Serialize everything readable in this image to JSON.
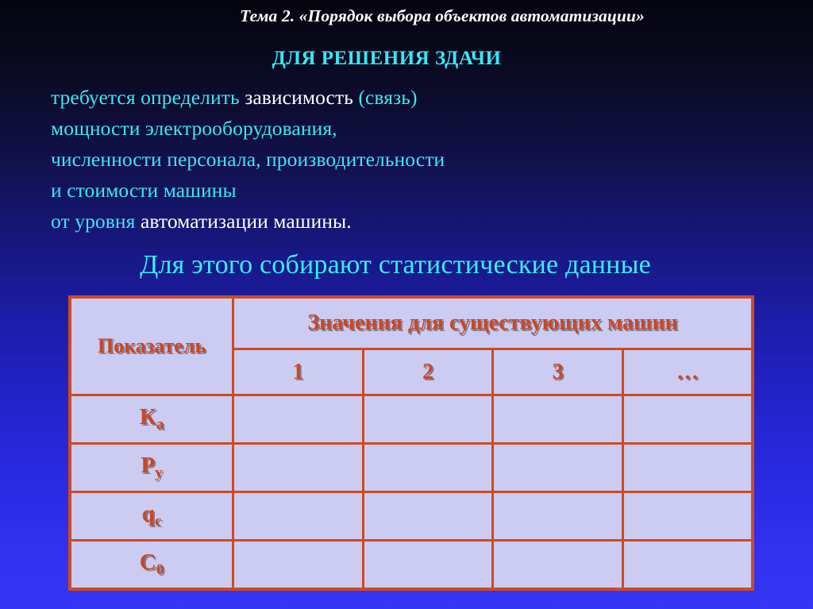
{
  "slide": {
    "title": "Тема 2. «Порядок выбора объектов автоматизации»",
    "sub_headline": "ДЛЯ РЕШЕНИЯ ЗДАЧИ",
    "statement": "Для этого собирают статистические данные",
    "body_lines": [
      {
        "segments": [
          {
            "text": "требуется определить ",
            "color": "cyan"
          },
          {
            "text": "зависимость ",
            "color": "white"
          },
          {
            "text": "(связь)",
            "color": "cyan"
          }
        ]
      },
      {
        "segments": [
          {
            "text": "мощности электрооборудования,",
            "color": "cyan"
          }
        ]
      },
      {
        "segments": [
          {
            "text": "численности персонала, производительности",
            "color": "cyan"
          }
        ]
      },
      {
        "segments": [
          {
            "text": "и стоимости машины",
            "color": "cyan"
          }
        ]
      },
      {
        "segments": [
          {
            "text": "от уровня ",
            "color": "cyan"
          },
          {
            "text": "автоматизации  машины.",
            "color": "white"
          }
        ]
      }
    ]
  },
  "table": {
    "indicator_header": "Показатель",
    "values_header": "Значения для существующих машин",
    "column_numbers": [
      "1",
      "2",
      "3",
      "…"
    ],
    "rows": [
      {
        "label_base": "К",
        "label_sub": "а",
        "values": [
          "",
          "",
          "",
          ""
        ]
      },
      {
        "label_base": "Р",
        "label_sub": "у",
        "values": [
          "",
          "",
          "",
          ""
        ]
      },
      {
        "label_base": "q",
        "label_sub": "с",
        "values": [
          "",
          "",
          "",
          ""
        ]
      },
      {
        "label_base": "С",
        "label_sub": "0",
        "values": [
          "",
          "",
          "",
          ""
        ]
      }
    ]
  },
  "colors": {
    "background_top": "#050510",
    "background_bottom": "#3535f5",
    "cyan_text": "#3fe6f2",
    "white_text": "#ffffff",
    "table_border": "#cc4b22",
    "table_fill": "#ccccf2",
    "table_text": "#cc4722"
  }
}
